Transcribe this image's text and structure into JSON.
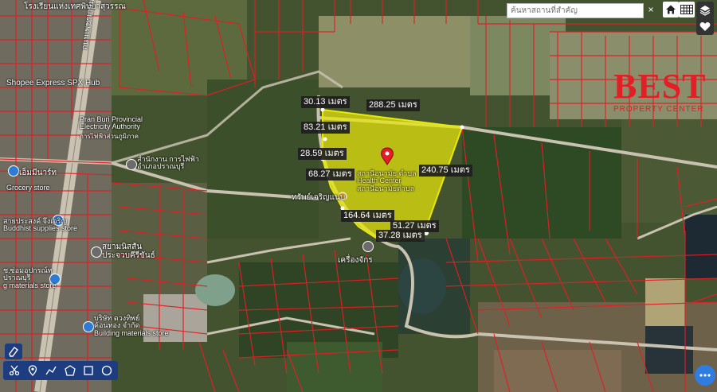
{
  "search": {
    "placeholder": "ค้นหาสถานที่สำคัญ"
  },
  "controls": {
    "close_label": "×",
    "home_icon": "home-icon",
    "grid_icon": "grid-icon",
    "layers_icon": "layers-icon",
    "favorite_icon": "heart-icon",
    "more_icon": "ellipsis-icon"
  },
  "toolbar": {
    "tools": [
      "eraser-icon",
      "scissors-icon",
      "pin-icon",
      "polyline-icon",
      "polygon-icon",
      "rectangle-icon",
      "circle-icon"
    ]
  },
  "measurements": [
    {
      "id": "m1",
      "text": "30.13 เมตร"
    },
    {
      "id": "m2",
      "text": "288.25 เมตร"
    },
    {
      "id": "m3",
      "text": "83.21 เมตร"
    },
    {
      "id": "m4",
      "text": "28.59 เมตร"
    },
    {
      "id": "m5",
      "text": "68.27 เมตร"
    },
    {
      "id": "m6",
      "text": "240.75 เมตร"
    },
    {
      "id": "m7",
      "text": "164.64 เมตร"
    },
    {
      "id": "m8",
      "text": "51.27 เมตร"
    },
    {
      "id": "m9",
      "text": "37.28 เมตร"
    }
  ],
  "places": [
    {
      "id": "p1",
      "text": "โรงเรียนแห่งเทศพิทยาสุวรรณ"
    },
    {
      "id": "p2",
      "text": "Shopee Express SPX Hub"
    },
    {
      "id": "p3",
      "text": "Pran Buri Provincial\nElectricity Authority"
    },
    {
      "id": "p4",
      "text": "การไฟฟ้าส่วนภูมิภาค"
    },
    {
      "id": "p5",
      "text": "สำนักงาน การไฟฟ้า\nอำเภอปราณบุรี"
    },
    {
      "id": "p6",
      "text": "เอ็มมีนาร์ท"
    },
    {
      "id": "p7",
      "text": "Grocery store"
    },
    {
      "id": "p8",
      "text": "สายประสงค์ จึงเจริญ\nBuddhist supplies store"
    },
    {
      "id": "p9",
      "text": "สยามนิสสัน\nประจวบคีรีขันธ์"
    },
    {
      "id": "p10",
      "text": "ช.ซ่อมอุปกรณ์ท\nปราณบุรี\ng materials store"
    },
    {
      "id": "p11",
      "text": "บริษัท ดวงทิพย์\nค้อนทอง จำกัด\nBuilding materials store"
    },
    {
      "id": "p12",
      "text": "สถานีอนามัย ตำบล\nHealth Center\nสถานีอนามัยตำบล"
    },
    {
      "id": "p13",
      "text": "ทรัพย์เจริญแนบ"
    },
    {
      "id": "p14",
      "text": "เครื่องจักร"
    },
    {
      "id": "p15",
      "text": "ถนนเพชรเกษม"
    }
  ],
  "logo": {
    "text": "BEST",
    "tagline": "PROPERTY CENTER"
  },
  "colors": {
    "parcel": "#e31e24",
    "land_plot": "#e8e80a",
    "road": "#c9c2b0",
    "marker": "#e31e24",
    "logo_red": "#e31e24"
  }
}
